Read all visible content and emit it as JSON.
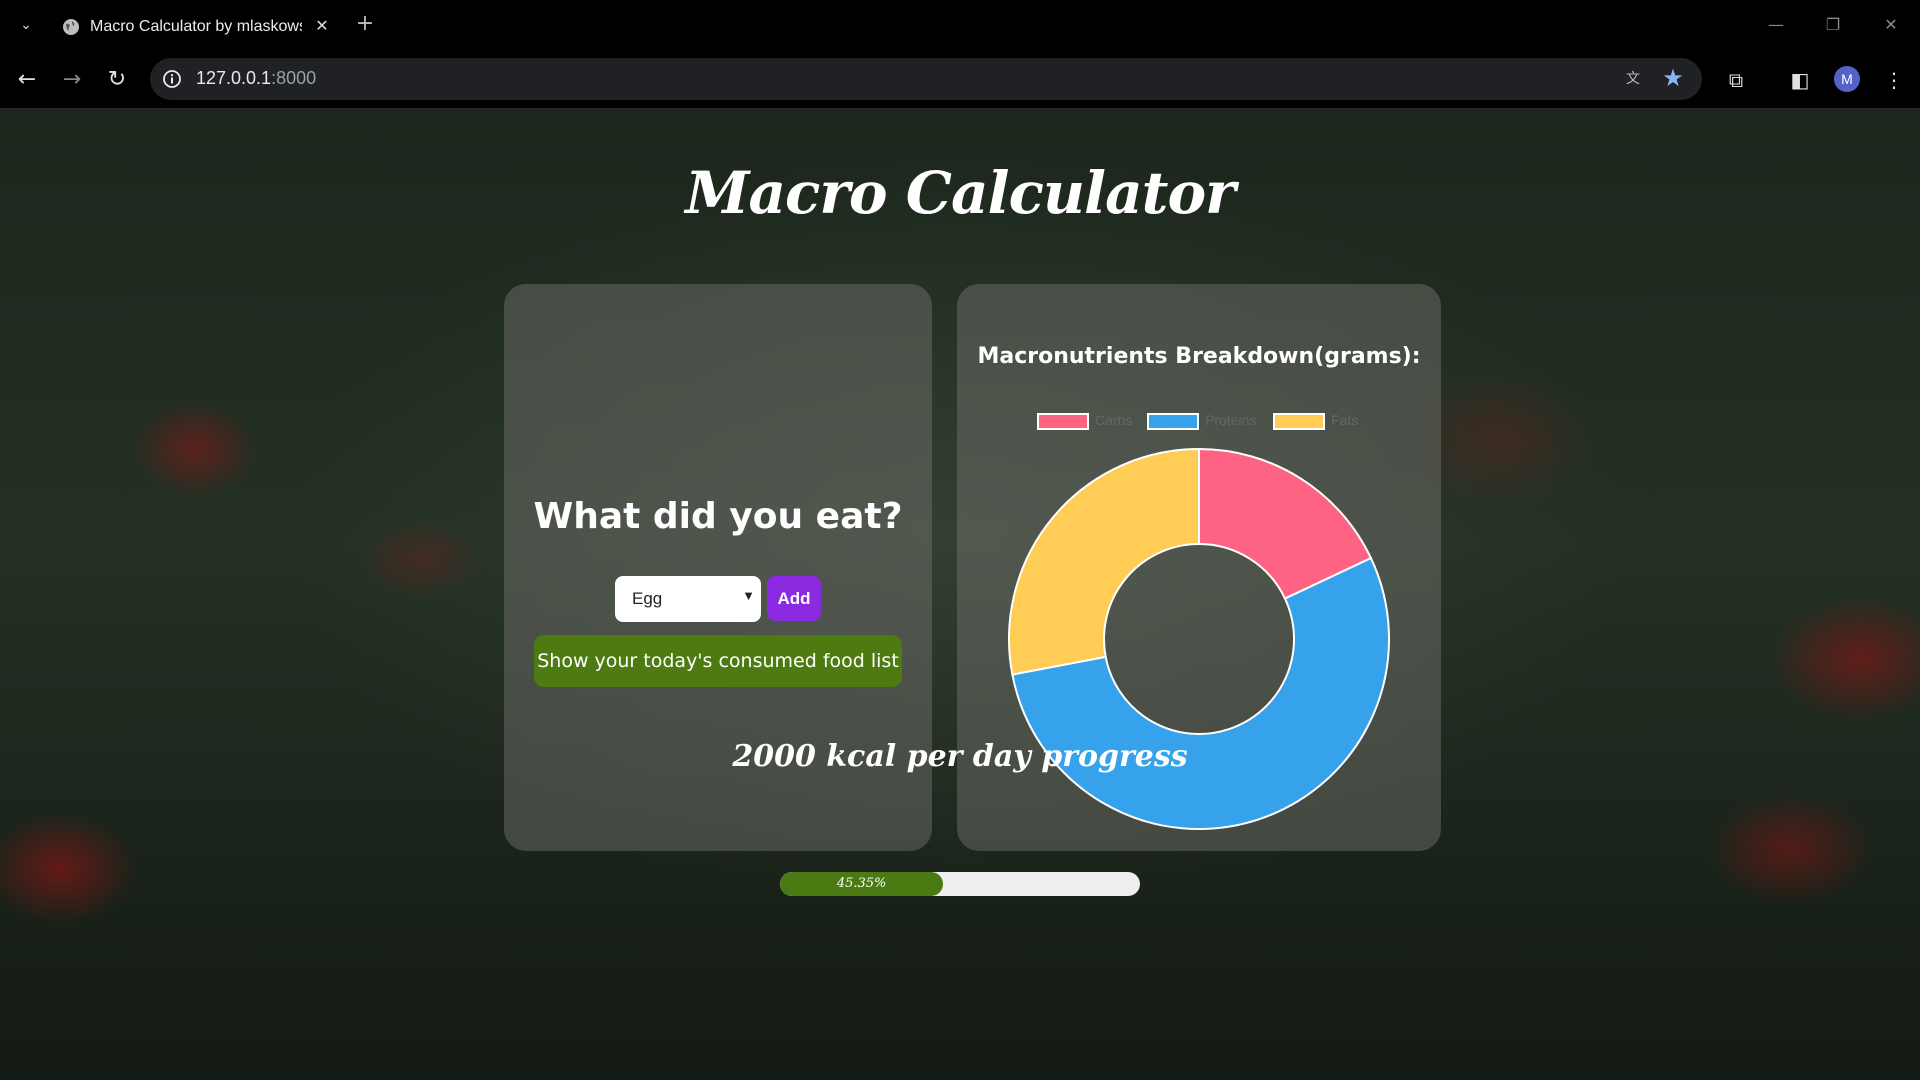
{
  "browser": {
    "tab_title": "Macro Calculator by mlaskowsk",
    "url_host": "127.0.0.1",
    "url_port": ":8000",
    "avatar_letter": "M"
  },
  "page": {
    "title": "Macro Calculator",
    "question": "What did you eat?",
    "food_select": {
      "selected": "Egg"
    },
    "add_button": "Add",
    "show_list_button": "Show your today's consumed food list",
    "progress_title": "2000 kcal per day progress",
    "progress": {
      "percent": 45.35,
      "label": "45.35%"
    }
  },
  "chart_data": {
    "type": "pie",
    "title": "Macronutrients Breakdown(grams):",
    "legend_position": "top",
    "categories": [
      "Carbs",
      "Proteins",
      "Fats"
    ],
    "values": [
      18,
      54,
      28
    ],
    "colors": [
      "#ff6384",
      "#36a2eb",
      "#ffcd56"
    ]
  }
}
